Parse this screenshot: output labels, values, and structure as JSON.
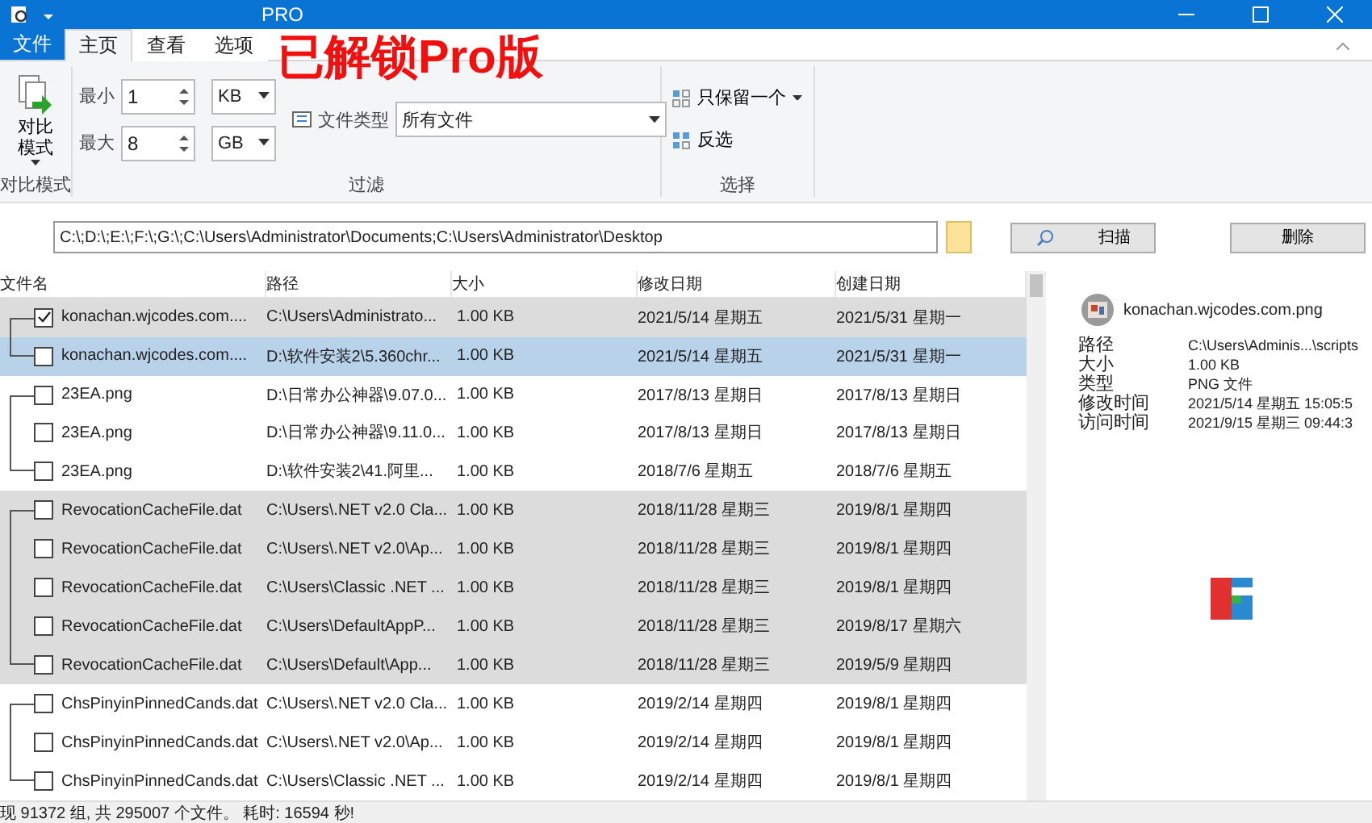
{
  "window": {
    "title": "PRO"
  },
  "overlay_caption": "已解锁Pro版",
  "menu_tab": "文件",
  "tabs": [
    {
      "label": "主页",
      "selected": true
    },
    {
      "label": "查看",
      "selected": false
    },
    {
      "label": "选项",
      "selected": false
    }
  ],
  "ribbon": {
    "compare": {
      "label_lines": [
        "对比",
        "模式"
      ],
      "group": "对比模式"
    },
    "filter": {
      "group": "过滤",
      "min_label": "最小",
      "min_value": "1",
      "min_unit": "KB",
      "max_label": "最大",
      "max_value": "8",
      "max_unit": "GB",
      "type_label": "文件类型",
      "type_value": "所有文件"
    },
    "select": {
      "group": "选择",
      "keep_one": "只保留一个",
      "invert": "反选"
    }
  },
  "paths": "C:\\;D:\\;E:\\;F:\\;G:\\;C:\\Users\\Administrator\\Documents;C:\\Users\\Administrator\\Desktop",
  "scan_button": "扫描",
  "delete_button": "删除",
  "columns": [
    "文件名",
    "路径",
    "大小",
    "修改日期",
    "创建日期"
  ],
  "groups": [
    {
      "shaded": true,
      "rows": [
        {
          "name": "konachan.wjcodes.com....",
          "path": "C:\\Users\\Administrato...",
          "size": "1.00 KB",
          "modified": "2021/5/14 星期五",
          "created": "2021/5/31 星期一",
          "checked": true,
          "selected": false
        },
        {
          "name": "konachan.wjcodes.com....",
          "path": "D:\\软件安装2\\5.360chr...",
          "size": "1.00 KB",
          "modified": "2021/5/14 星期五",
          "created": "2021/5/31 星期一",
          "checked": false,
          "selected": true
        }
      ]
    },
    {
      "shaded": false,
      "rows": [
        {
          "name": "23EA.png",
          "path": "D:\\日常办公神器\\9.07.0...",
          "size": "1.00 KB",
          "modified": "2017/8/13 星期日",
          "created": "2017/8/13 星期日",
          "checked": false,
          "selected": false
        },
        {
          "name": "23EA.png",
          "path": "D:\\日常办公神器\\9.11.0...",
          "size": "1.00 KB",
          "modified": "2017/8/13 星期日",
          "created": "2017/8/13 星期日",
          "checked": false,
          "selected": false
        },
        {
          "name": "23EA.png",
          "path": "D:\\软件安装2\\41.阿里...",
          "size": "1.00 KB",
          "modified": "2018/7/6 星期五",
          "created": "2018/7/6 星期五",
          "checked": false,
          "selected": false
        }
      ]
    },
    {
      "shaded": true,
      "rows": [
        {
          "name": "RevocationCacheFile.dat",
          "path": "C:\\Users\\.NET v2.0 Cla...",
          "size": "1.00 KB",
          "modified": "2018/11/28 星期三",
          "created": "2019/8/1 星期四",
          "checked": false,
          "selected": false
        },
        {
          "name": "RevocationCacheFile.dat",
          "path": "C:\\Users\\.NET v2.0\\Ap...",
          "size": "1.00 KB",
          "modified": "2018/11/28 星期三",
          "created": "2019/8/1 星期四",
          "checked": false,
          "selected": false
        },
        {
          "name": "RevocationCacheFile.dat",
          "path": "C:\\Users\\Classic .NET ...",
          "size": "1.00 KB",
          "modified": "2018/11/28 星期三",
          "created": "2019/8/1 星期四",
          "checked": false,
          "selected": false
        },
        {
          "name": "RevocationCacheFile.dat",
          "path": "C:\\Users\\DefaultAppP...",
          "size": "1.00 KB",
          "modified": "2018/11/28 星期三",
          "created": "2019/8/17 星期六",
          "checked": false,
          "selected": false
        },
        {
          "name": "RevocationCacheFile.dat",
          "path": "C:\\Users\\Default\\App...",
          "size": "1.00 KB",
          "modified": "2018/11/28 星期三",
          "created": "2019/5/9 星期四",
          "checked": false,
          "selected": false
        }
      ]
    },
    {
      "shaded": false,
      "rows": [
        {
          "name": "ChsPinyinPinnedCands.dat",
          "path": "C:\\Users\\.NET v2.0 Cla...",
          "size": "1.00 KB",
          "modified": "2019/2/14 星期四",
          "created": "2019/8/1 星期四",
          "checked": false,
          "selected": false
        },
        {
          "name": "ChsPinyinPinnedCands.dat",
          "path": "C:\\Users\\.NET v2.0\\Ap...",
          "size": "1.00 KB",
          "modified": "2019/2/14 星期四",
          "created": "2019/8/1 星期四",
          "checked": false,
          "selected": false
        },
        {
          "name": "ChsPinyinPinnedCands.dat",
          "path": "C:\\Users\\Classic .NET ...",
          "size": "1.00 KB",
          "modified": "2019/2/14 星期四",
          "created": "2019/8/1 星期四",
          "checked": false,
          "selected": false
        }
      ]
    }
  ],
  "details": {
    "file_name": "konachan.wjcodes.com.png",
    "fields": [
      {
        "label": "路径",
        "value": "C:\\Users\\Adminis...\\scripts"
      },
      {
        "label": "大小",
        "value": "1.00 KB"
      },
      {
        "label": "类型",
        "value": "PNG 文件"
      },
      {
        "label": "修改时间",
        "value": "2021/5/14 星期五 15:05:5"
      },
      {
        "label": "访问时间",
        "value": "2021/9/15 星期三 09:44:3"
      }
    ]
  },
  "status_bar": "现 91372 组, 共 295007 个文件。 耗时: 16594 秒!"
}
